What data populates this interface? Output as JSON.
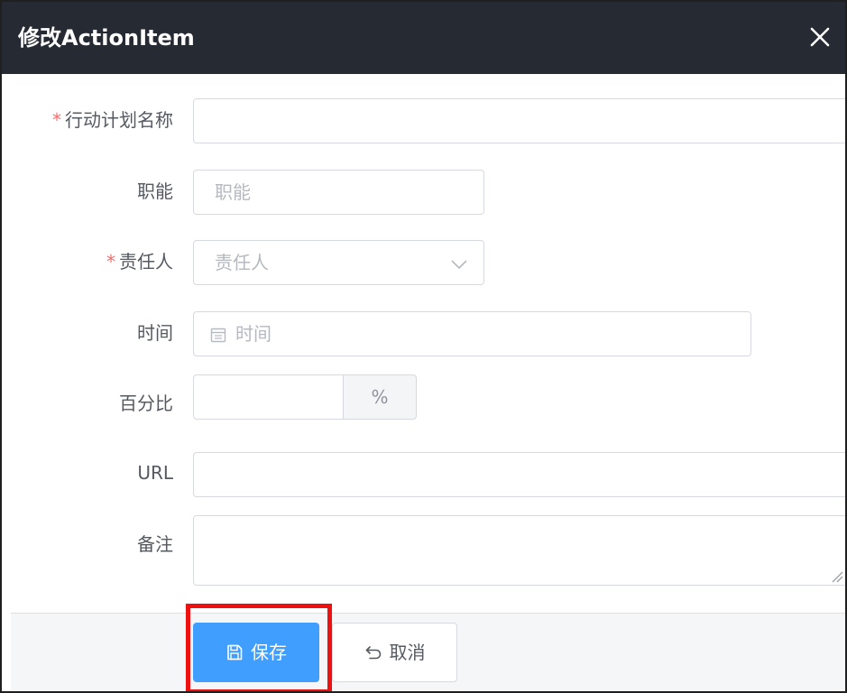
{
  "dialog": {
    "title": "修改ActionItem",
    "close_icon": "close-icon"
  },
  "form": {
    "required_mark": "*",
    "action_name": {
      "label": "行动计划名称",
      "value": "",
      "required": true
    },
    "function": {
      "label": "职能",
      "placeholder": "职能",
      "value": ""
    },
    "owner": {
      "label": "责任人",
      "placeholder": "责任人",
      "value": "",
      "required": true,
      "dropdown_icon": "chevron-down-icon"
    },
    "time": {
      "label": "时间",
      "placeholder": "时间",
      "value": "",
      "icon": "calendar-icon"
    },
    "percent": {
      "label": "百分比",
      "value": "",
      "suffix": "%"
    },
    "url": {
      "label": "URL",
      "value": ""
    },
    "remark": {
      "label": "备注",
      "value": ""
    }
  },
  "footer": {
    "save_label": "保存",
    "save_icon": "save-icon",
    "cancel_label": "取消",
    "cancel_icon": "undo-icon"
  },
  "colors": {
    "header_bg": "#262a33",
    "primary": "#409eff",
    "required": "#f56c6c",
    "highlight": "#ee1111"
  }
}
